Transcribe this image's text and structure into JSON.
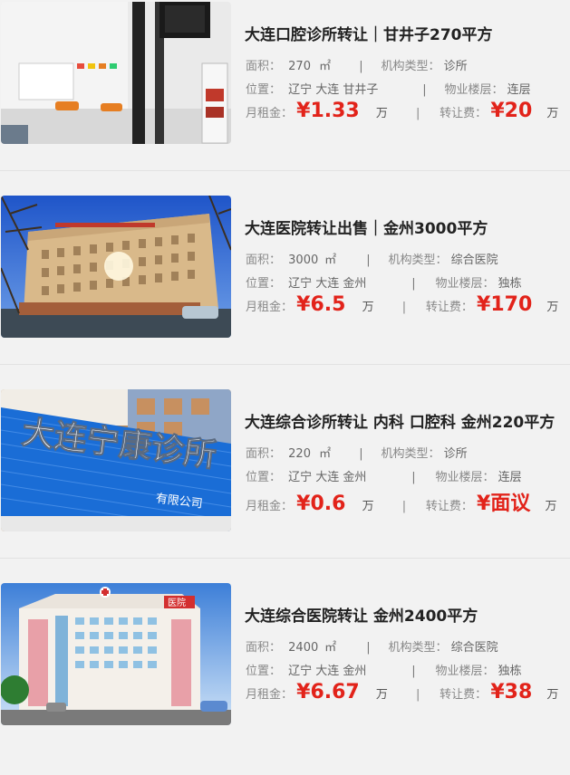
{
  "labels": {
    "area": "面积：",
    "org_type": "机构类型：",
    "location": "位置：",
    "floor": "物业楼层：",
    "rent": "月租金：",
    "transfer_fee": "转让费：",
    "area_unit": "㎡",
    "money_unit": "万",
    "separator": "|"
  },
  "listings": [
    {
      "title": "大连口腔诊所转让｜甘井子270平方",
      "area": "270",
      "org_type": "诊所",
      "location": "辽宁 大连 甘井子",
      "floor": "连层",
      "rent": "¥1.33",
      "transfer_fee": "¥20",
      "transfer_unit": "万"
    },
    {
      "title": "大连医院转让出售｜金州3000平方",
      "area": "3000",
      "org_type": "综合医院",
      "location": "辽宁 大连 金州",
      "floor": "独栋",
      "rent": "¥6.5",
      "transfer_fee": "¥170",
      "transfer_unit": "万"
    },
    {
      "title": "大连综合诊所转让 内科 口腔科 金州220平方",
      "area": "220",
      "org_type": "诊所",
      "location": "辽宁 大连 金州",
      "floor": "连层",
      "rent": "¥0.6",
      "transfer_fee": "¥面议",
      "transfer_unit": "万",
      "sign_text": "大连宁康诊所",
      "sign_sub": "有限公司"
    },
    {
      "title": "大连综合医院转让 金州2400平方",
      "area": "2400",
      "org_type": "综合医院",
      "location": "辽宁 大连 金州",
      "floor": "独栋",
      "rent": "¥6.67",
      "transfer_fee": "¥38",
      "transfer_unit": "万",
      "sign_text": "医院"
    }
  ]
}
